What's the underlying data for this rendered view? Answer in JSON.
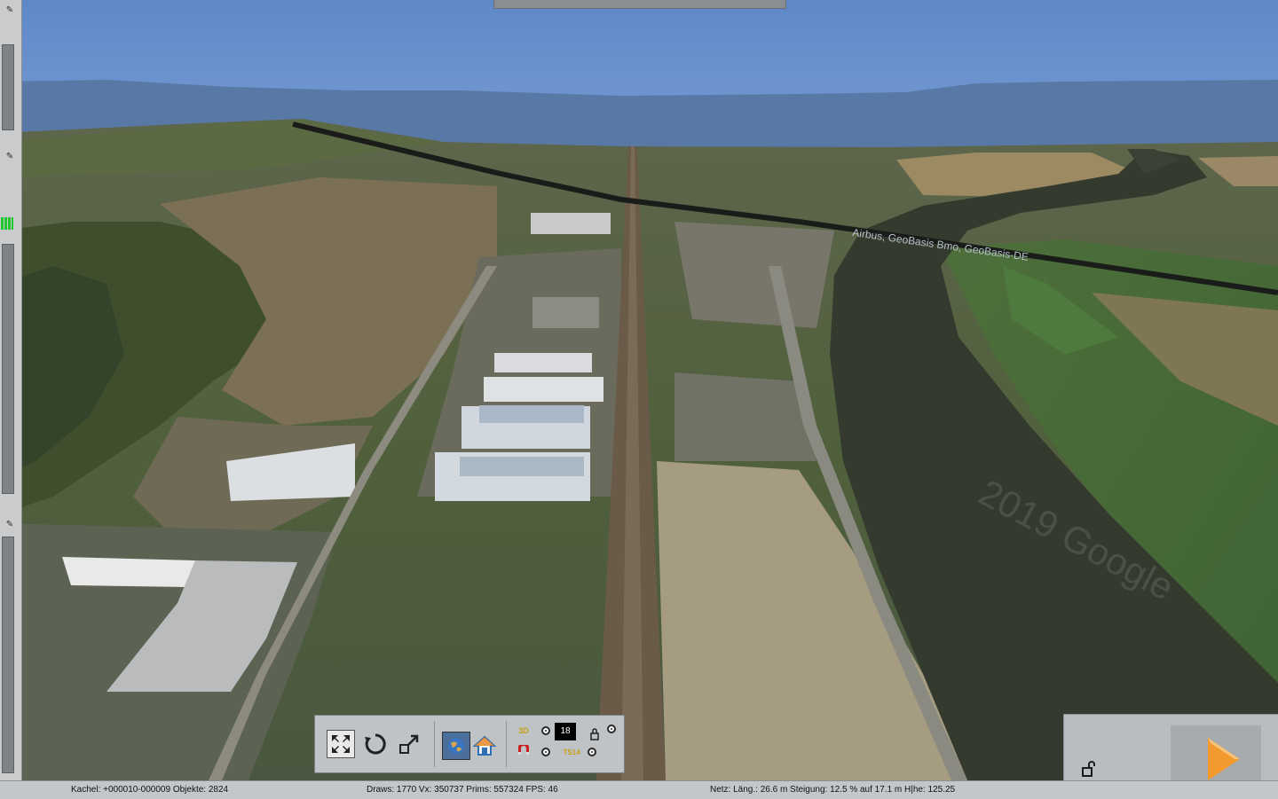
{
  "viewport": {
    "watermark": "2019 Google",
    "copyright_overlay": "Airbus, GeoBasis Bmo, GeoBasis-DE"
  },
  "toolbar": {
    "buttons": [
      {
        "icon": "fullscreen-icon"
      },
      {
        "icon": "rotate-icon"
      },
      {
        "icon": "resize-icon"
      },
      {
        "icon": "globe-icon"
      },
      {
        "icon": "home-icon"
      }
    ],
    "speed_value": "18",
    "ts_label": "TS14",
    "three_d_label": "3D"
  },
  "play_panel": {
    "play_icon": "play-icon",
    "lock_icon": "lock-open-icon"
  },
  "status": {
    "kachel": "Kachel: +000010-000009  Objekte: 2824",
    "draws": "Draws: 1770 Vx: 350737 Prims: 557324 FPS: 46",
    "netz": "Netz:  Läng.:    26.6 m Steigung: 12.5 % auf 17.1 m H|he: 125.25"
  },
  "colors": {
    "sky": "#5f86c4",
    "mountains": "#5878a6",
    "river": "#343b2e",
    "accent_play": "#f29a2e"
  }
}
